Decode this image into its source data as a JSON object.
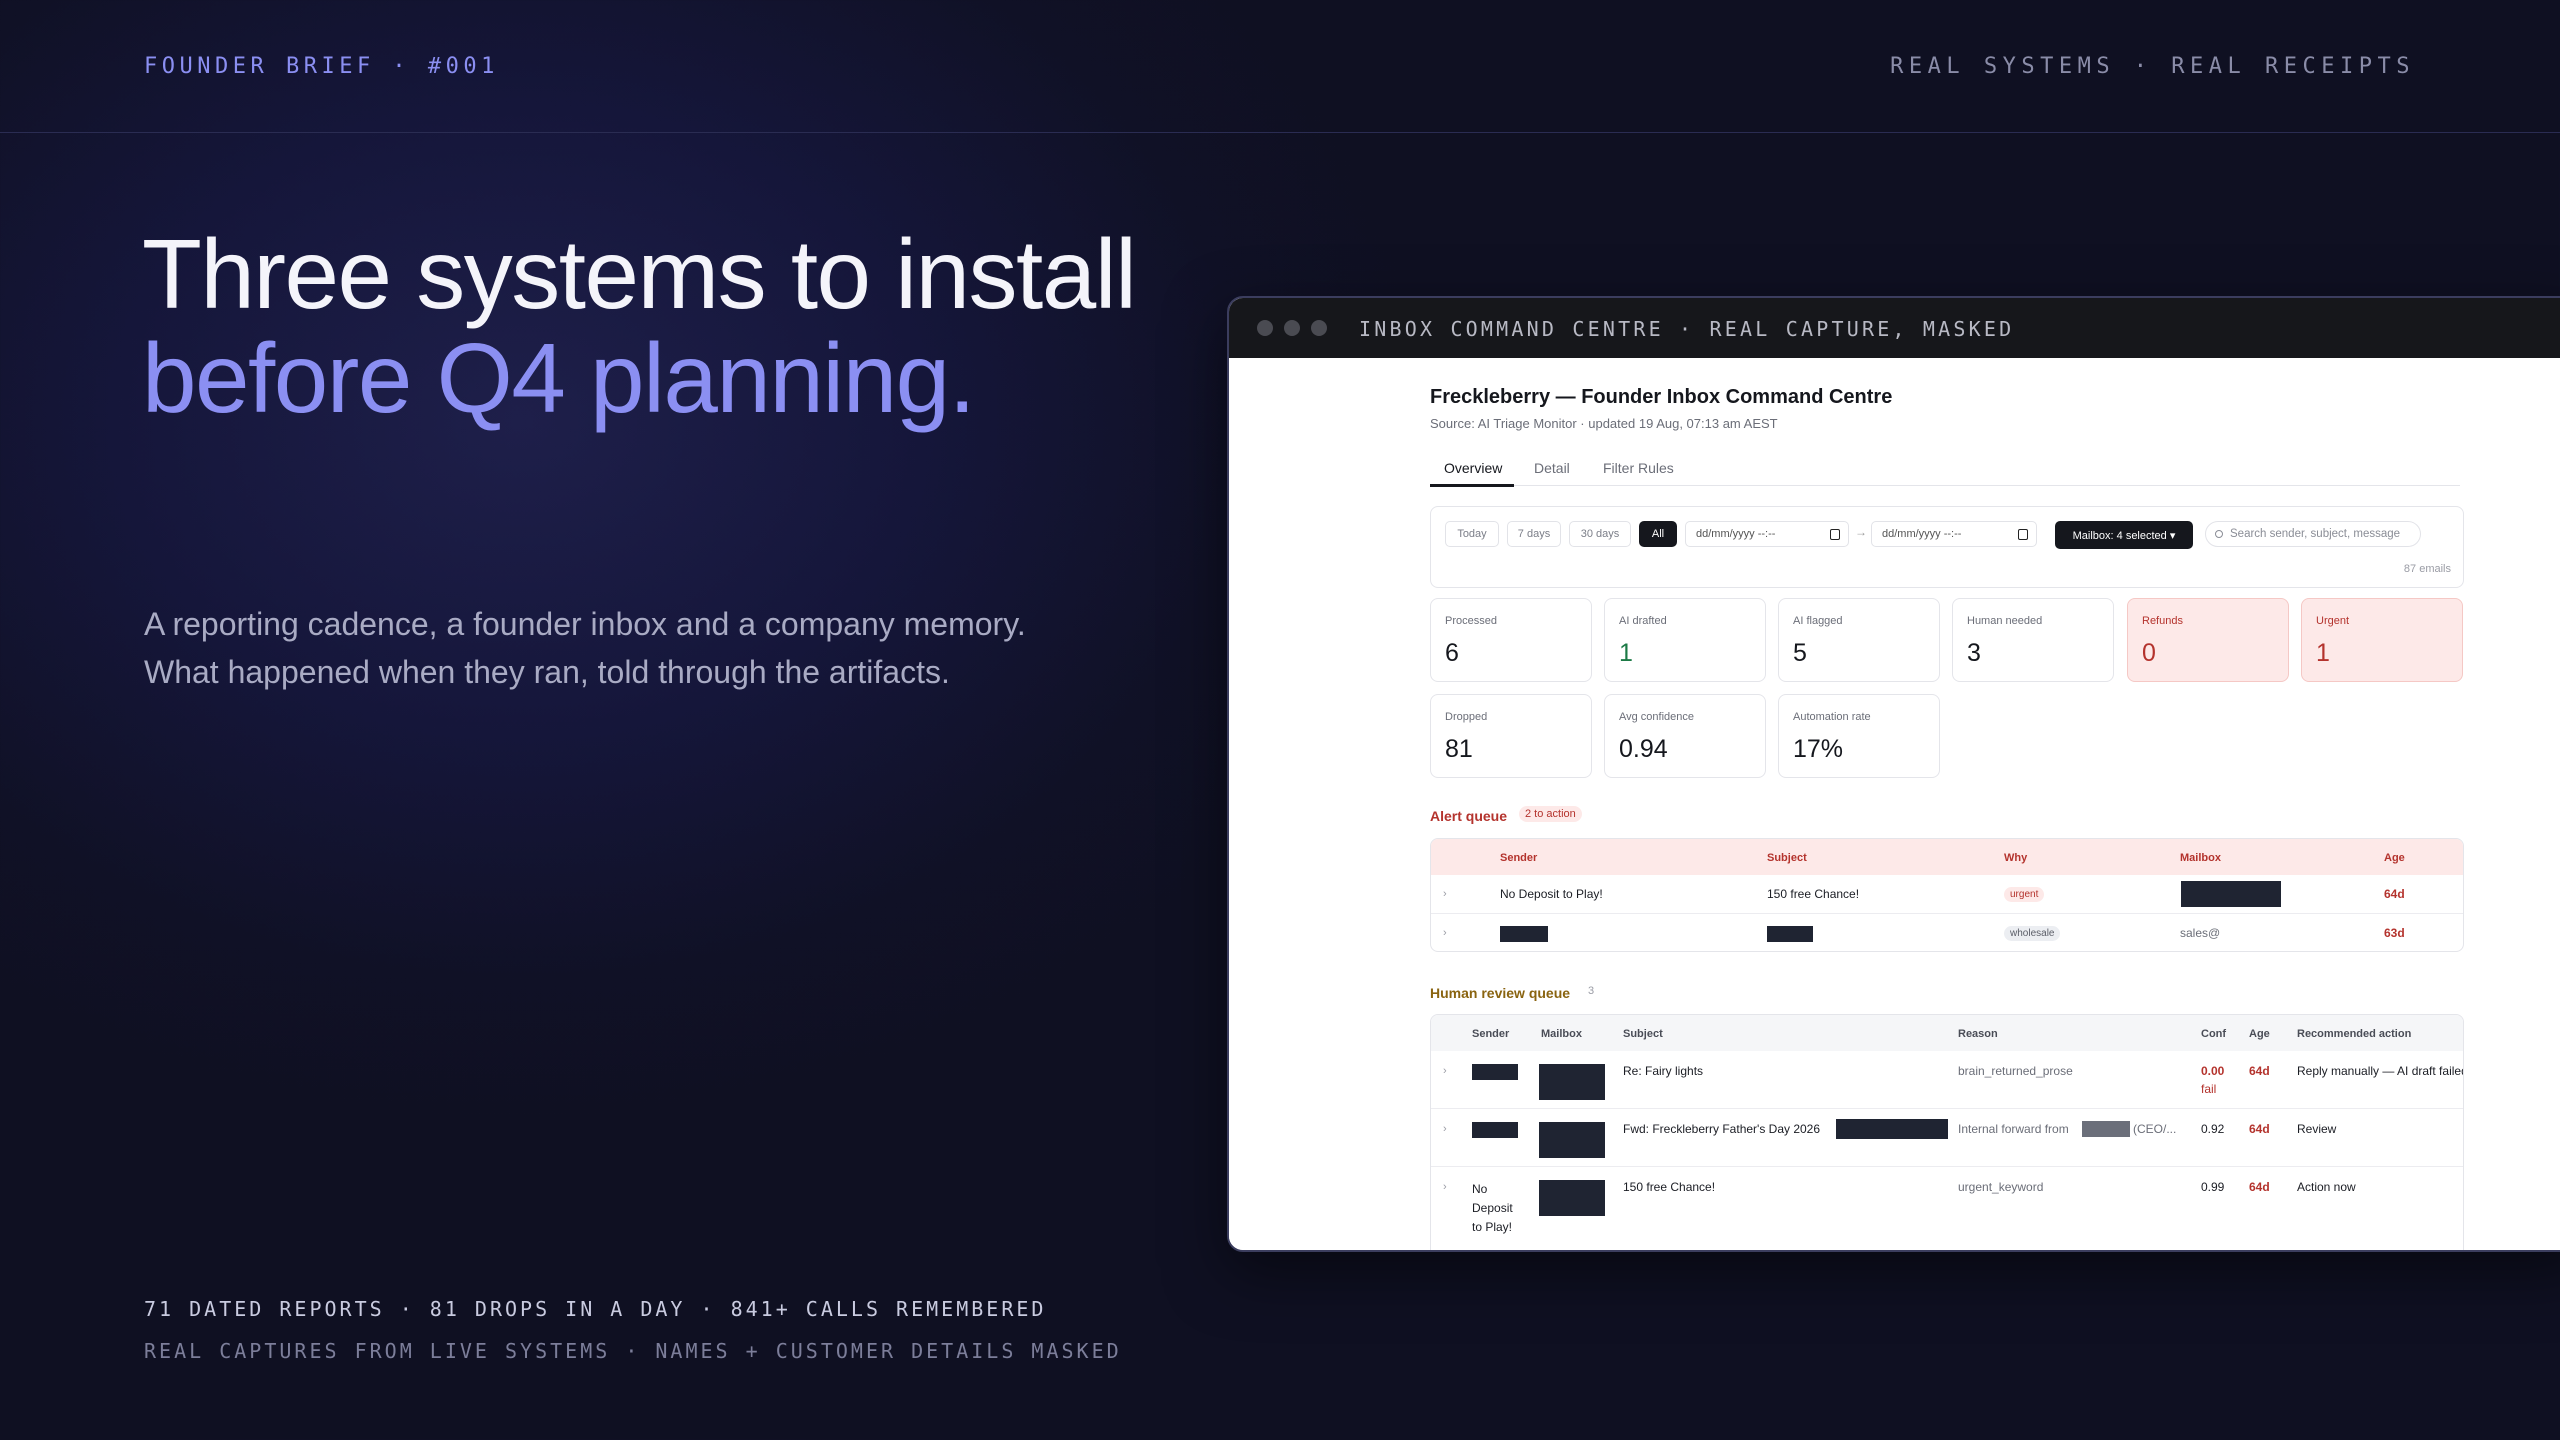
{
  "header": {
    "brief": "FOUNDER BRIEF · #001",
    "tagline": "REAL SYSTEMS · REAL RECEIPTS"
  },
  "hero": {
    "line1": "Three systems to install",
    "line2": "before Q4 planning.",
    "lede1": "A reporting cadence, a founder inbox and a company memory.",
    "lede2": "What happened when they ran, told through the artifacts."
  },
  "footer": {
    "stats": "71 DATED REPORTS · 81 DROPS IN A DAY · 841+ CALLS REMEMBERED",
    "caption": "REAL CAPTURES FROM LIVE SYSTEMS · NAMES + CUSTOMER DETAILS MASKED"
  },
  "window": {
    "title": "INBOX COMMAND CENTRE · REAL CAPTURE, MASKED"
  },
  "app": {
    "title": "Freckleberry — Founder Inbox Command Centre",
    "source": "Source: AI Triage Monitor · updated 19 Aug, 07:13 am AEST",
    "tabs": [
      "Overview",
      "Detail",
      "Filter Rules"
    ],
    "filters": {
      "ranges": [
        "Today",
        "7 days",
        "30 days",
        "All"
      ],
      "date_placeholder": "dd/mm/yyyy --:--",
      "arrow": "→",
      "mailbox": "Mailbox: 4 selected ▾",
      "search_placeholder": "Search sender, subject, message",
      "count": "87 emails"
    },
    "metrics": [
      {
        "label": "Processed",
        "value": "6"
      },
      {
        "label": "AI drafted",
        "value": "1"
      },
      {
        "label": "AI flagged",
        "value": "5"
      },
      {
        "label": "Human needed",
        "value": "3"
      },
      {
        "label": "Refunds",
        "value": "0"
      },
      {
        "label": "Urgent",
        "value": "1"
      },
      {
        "label": "Dropped",
        "value": "81"
      },
      {
        "label": "Avg confidence",
        "value": "0.94"
      },
      {
        "label": "Automation rate",
        "value": "17%"
      }
    ],
    "alert": {
      "title": "Alert queue",
      "badge": "2 to action",
      "headers": [
        "Sender",
        "Subject",
        "Why",
        "Mailbox",
        "Age"
      ],
      "rows": [
        {
          "sender": "No Deposit to Play!",
          "subject": "150 free Chance!",
          "why": "urgent",
          "mailbox": "",
          "age": "64d"
        },
        {
          "sender": "",
          "subject": "",
          "why": "wholesale",
          "mailbox": "sales@",
          "age": "63d"
        }
      ]
    },
    "review": {
      "title": "Human review queue",
      "badge": "3",
      "headers": [
        "Sender",
        "Mailbox",
        "Subject",
        "Reason",
        "Conf",
        "Age",
        "Recommended action"
      ],
      "rows": [
        {
          "sender": "",
          "subject": "Re: Fairy lights",
          "reason": "brain_returned_prose",
          "conf": "0.00",
          "conf2": "fail",
          "age": "64d",
          "action": "Reply manually — AI draft failed"
        },
        {
          "sender": "",
          "subject": "Fwd: Freckleberry Father's Day 2026",
          "reason_a": "Internal forward from",
          "reason_b": "(CEO/...",
          "conf": "0.92",
          "age": "64d",
          "action": "Review"
        },
        {
          "sender_lines": [
            "No",
            "Deposit",
            "to Play!"
          ],
          "subject": "150 free Chance!",
          "reason": "urgent_keyword",
          "conf": "0.99",
          "age": "64d",
          "action": "Action now"
        }
      ]
    }
  }
}
